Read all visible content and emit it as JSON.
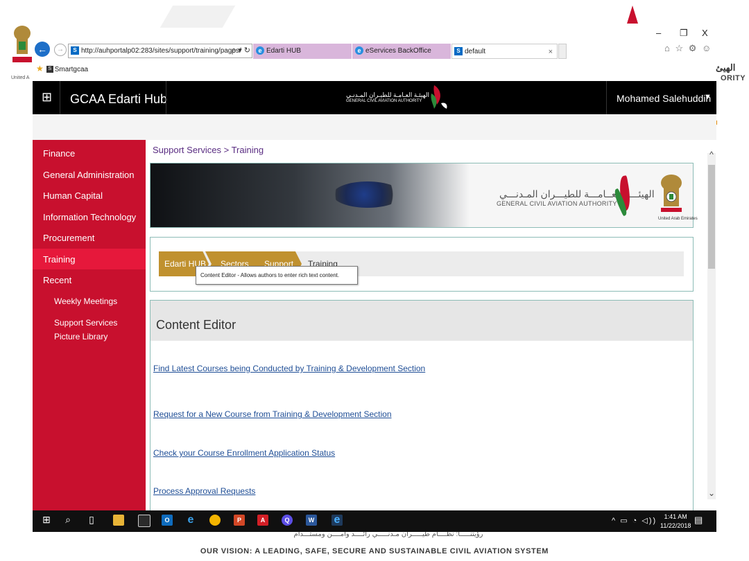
{
  "window": {
    "minimize_glyph": "–",
    "restore_glyph": "❐",
    "close_glyph": "X"
  },
  "browser": {
    "address": "http://auhportalp02:283/sites/support/training/pages/",
    "address_tools": "ρ ▾ ↻",
    "tabs": [
      {
        "label": "Edarti HUB",
        "icon": "ie-icon",
        "color": "#d9b6db"
      },
      {
        "label": "eServices BackOffice",
        "icon": "ie-icon",
        "color": "#d9b6db"
      },
      {
        "label": "default",
        "icon": "sharepoint-icon",
        "active": true
      }
    ],
    "tab_close_glyph": "×",
    "favorites_bar": {
      "item": "Smartgcaa"
    },
    "tool_icons": "⌂ ☆ ⚙ ☺"
  },
  "suitebar": {
    "title": "GCAA Edarti Hub",
    "logo_ar": "الهيئـة العـامـة للطيـران المـدنـي",
    "logo_en": "GENERAL CIVIL AVIATION AUTHORITY",
    "user": "Mohamed Salehuddin",
    "caret": "▼"
  },
  "leftnav": {
    "items": [
      {
        "label": "Finance"
      },
      {
        "label": "General Administration"
      },
      {
        "label": "Human Capital"
      },
      {
        "label": "Information Technology"
      },
      {
        "label": "Procurement"
      },
      {
        "label": "Training",
        "selected": true
      },
      {
        "label": "Recent"
      }
    ],
    "recent": [
      {
        "label": "Weekly Meetings"
      },
      {
        "label": "Support Services Picture Library"
      }
    ]
  },
  "main": {
    "breadcrumb_top": "Support Services > Training",
    "banner": {
      "arabic": "الهيئـــة العــامـــة للطيـــران المـدنـــي",
      "english": "GENERAL CIVIL AVIATION AUTHORITY",
      "emblem_caption": "United Arab Emirates"
    },
    "crumbs": [
      "Edarti HUB",
      "Sectors",
      "Support",
      "Training"
    ],
    "tooltip": "Content Editor - Allows authors to enter rich text content.",
    "editor": {
      "title": "Content Editor",
      "links": [
        "Find Latest Courses being Conducted by Training & Development Section",
        "Request for a New Course from Training & Development Section",
        "Check your Course Enrollment Application Status",
        "Process Approval Requests"
      ]
    }
  },
  "taskbar": {
    "time": "1:41 AM",
    "date": "11/22/2018",
    "tray": "^ ▭ ◔ ◁))"
  },
  "background": {
    "arabic_right": "الهيئ",
    "authority_right": "ORITY",
    "emblem_text": "United A",
    "vision": "OUR VISION: A LEADING, SAFE, SECURE AND SUSTAINABLE CIVIL AVIATION SYSTEM",
    "arabic_bottom": "رؤيتنـــــا: نظــــام طيـــــران مـدنـــــي رائــــد وآمــــن ومستـــدام"
  },
  "colors": {
    "brand_red": "#c8102e",
    "suite_black": "#000000",
    "crumb_gold": "#c0912f",
    "link_blue": "#1f4e96"
  }
}
